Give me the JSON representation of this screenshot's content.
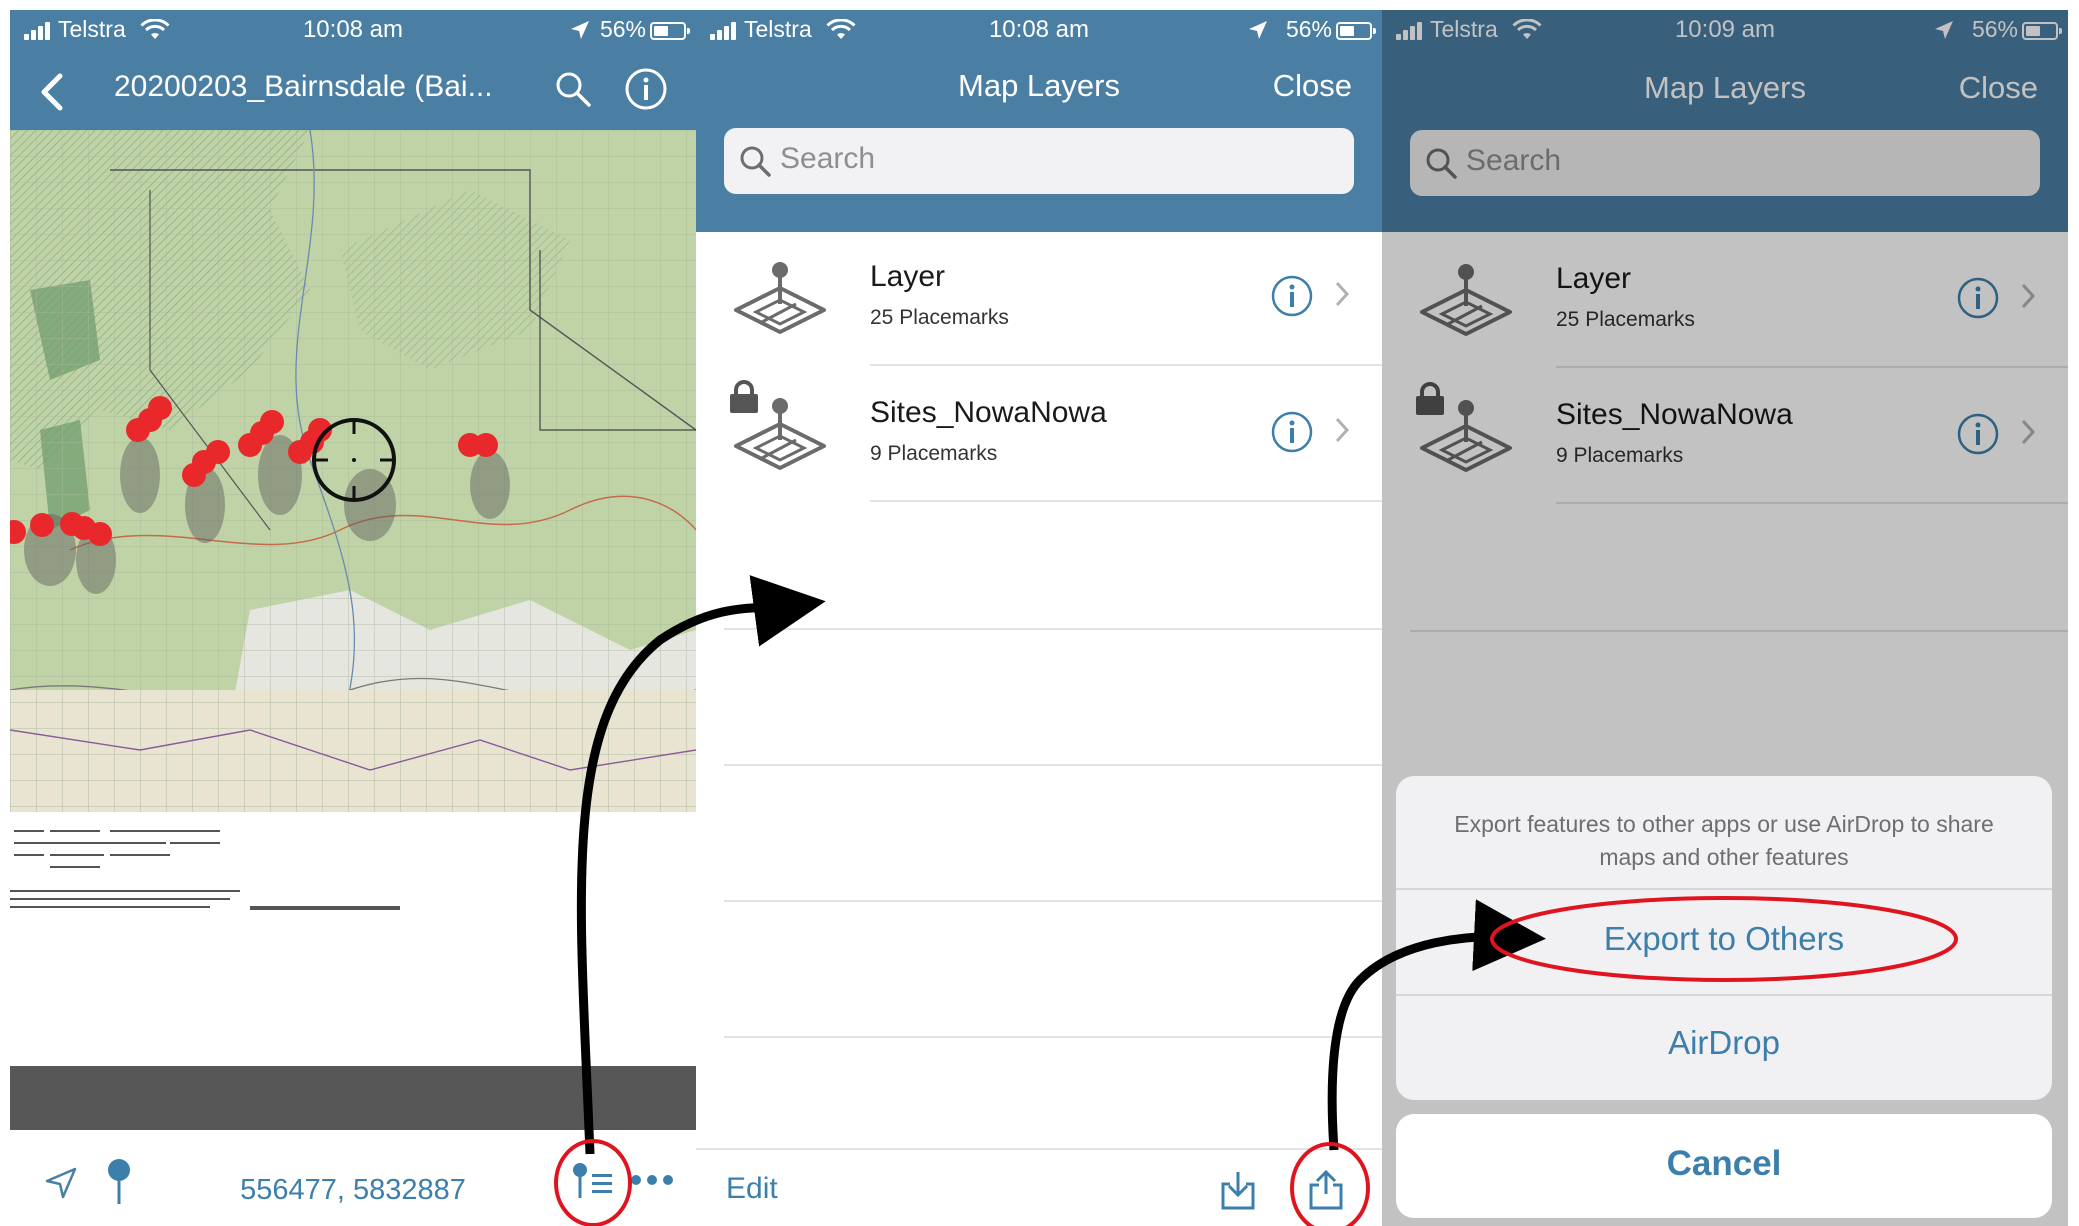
{
  "status_left": {
    "carrier": "Telstra",
    "time": "10:08 am",
    "battery": "56%"
  },
  "status_mid": {
    "carrier": "Telstra",
    "time": "10:08 am",
    "battery": "56%"
  },
  "status_right": {
    "carrier": "Telstra",
    "time": "10:09 am",
    "battery": "56%"
  },
  "map_screen": {
    "title": "20200203_Bairnsdale (Bai...",
    "coordinates": "556477, 5832887"
  },
  "layers_screen": {
    "title": "Map Layers",
    "close_label": "Close",
    "search_placeholder": "Search",
    "edit_label": "Edit",
    "layers": [
      {
        "name": "Layer",
        "count": "25 Placemarks",
        "locked": false
      },
      {
        "name": "Sites_NowaNowa",
        "count": "9 Placemarks",
        "locked": true
      }
    ]
  },
  "export_sheet": {
    "message": "Export features to other apps or use AirDrop to share maps and other features",
    "export_label": "Export to Others",
    "airdrop_label": "AirDrop",
    "cancel_label": "Cancel"
  },
  "colors": {
    "nav": "#4a7fa3",
    "accent": "#3d7fab",
    "highlight": "#e0141e",
    "pin": "#e8282a"
  }
}
